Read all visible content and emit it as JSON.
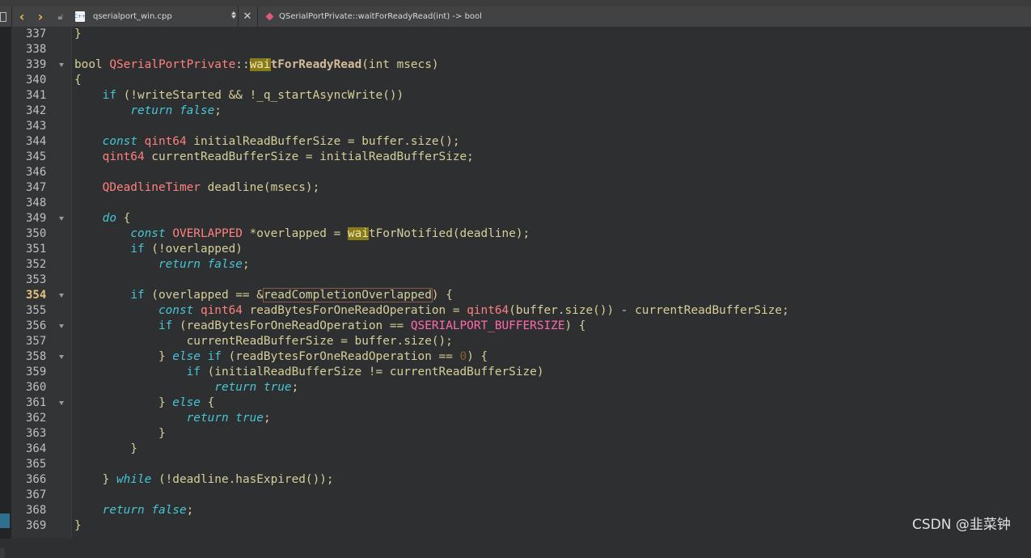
{
  "toolbar": {
    "file_name": "qserialport_win.cpp",
    "file_icon_text": "C++",
    "symbol": "QSerialPortPrivate::waitForReadyRead(int) -> bool"
  },
  "gutter": {
    "lines": [
      {
        "n": "337"
      },
      {
        "n": "338"
      },
      {
        "n": "339",
        "fold": true
      },
      {
        "n": "340"
      },
      {
        "n": "341"
      },
      {
        "n": "342"
      },
      {
        "n": "343"
      },
      {
        "n": "344"
      },
      {
        "n": "345"
      },
      {
        "n": "346"
      },
      {
        "n": "347"
      },
      {
        "n": "348"
      },
      {
        "n": "349",
        "fold": true
      },
      {
        "n": "350"
      },
      {
        "n": "351"
      },
      {
        "n": "352"
      },
      {
        "n": "353"
      },
      {
        "n": "354",
        "fold": true,
        "current": true
      },
      {
        "n": "355"
      },
      {
        "n": "356",
        "fold": true
      },
      {
        "n": "357"
      },
      {
        "n": "358",
        "fold": true
      },
      {
        "n": "359"
      },
      {
        "n": "360"
      },
      {
        "n": "361",
        "fold": true
      },
      {
        "n": "362"
      },
      {
        "n": "363"
      },
      {
        "n": "364"
      },
      {
        "n": "365"
      },
      {
        "n": "366"
      },
      {
        "n": "367"
      },
      {
        "n": "368"
      },
      {
        "n": "369"
      }
    ]
  },
  "code": [
    [
      [
        "p",
        "}"
      ]
    ],
    [],
    [
      [
        "p",
        "bool "
      ],
      [
        "t",
        "QSerialPortPrivate"
      ],
      [
        "p",
        "::"
      ],
      [
        "hl",
        "wai"
      ],
      [
        "f",
        "tForReadyRead"
      ],
      [
        "p",
        "(int msecs)"
      ]
    ],
    [
      [
        "p",
        "{"
      ]
    ],
    [
      [
        "p",
        "    "
      ],
      [
        "k",
        "if"
      ],
      [
        "p",
        " (!writeStarted && !_q_startAsyncWrite())"
      ]
    ],
    [
      [
        "p",
        "        "
      ],
      [
        "ki",
        "return"
      ],
      [
        "p",
        " "
      ],
      [
        "ki",
        "false"
      ],
      [
        "p",
        ";"
      ]
    ],
    [],
    [
      [
        "p",
        "    "
      ],
      [
        "ki",
        "const"
      ],
      [
        "p",
        " "
      ],
      [
        "t",
        "qint64"
      ],
      [
        "p",
        " initialReadBufferSize = buffer.size();"
      ]
    ],
    [
      [
        "p",
        "    "
      ],
      [
        "t",
        "qint64"
      ],
      [
        "p",
        " currentReadBufferSize = initialReadBufferSize;"
      ]
    ],
    [],
    [
      [
        "p",
        "    "
      ],
      [
        "t",
        "QDeadlineTimer"
      ],
      [
        "p",
        " deadline(msecs);"
      ]
    ],
    [],
    [
      [
        "p",
        "    "
      ],
      [
        "ki",
        "do"
      ],
      [
        "p",
        " {"
      ]
    ],
    [
      [
        "p",
        "        "
      ],
      [
        "ki",
        "const"
      ],
      [
        "p",
        " "
      ],
      [
        "t",
        "OVERLAPPED"
      ],
      [
        "p",
        " *overlapped = "
      ],
      [
        "hl",
        "wai"
      ],
      [
        "p",
        "tForNotified(deadline);"
      ]
    ],
    [
      [
        "p",
        "        "
      ],
      [
        "k",
        "if"
      ],
      [
        "p",
        " (!overlapped)"
      ]
    ],
    [
      [
        "p",
        "            "
      ],
      [
        "ki",
        "return"
      ],
      [
        "p",
        " "
      ],
      [
        "ki",
        "false"
      ],
      [
        "p",
        ";"
      ]
    ],
    [],
    [
      [
        "p",
        "        "
      ],
      [
        "k",
        "if"
      ],
      [
        "p",
        " (overlapped == &"
      ],
      [
        "box",
        "readCompletionOverlapped"
      ],
      [
        "p",
        ") {"
      ]
    ],
    [
      [
        "p",
        "            "
      ],
      [
        "ki",
        "const"
      ],
      [
        "p",
        " "
      ],
      [
        "t",
        "qint64"
      ],
      [
        "p",
        " readBytesForOneReadOperation = "
      ],
      [
        "t",
        "qint64"
      ],
      [
        "p",
        "(buffer.size()) - currentReadBufferSize;"
      ]
    ],
    [
      [
        "p",
        "            "
      ],
      [
        "k",
        "if"
      ],
      [
        "p",
        " (readBytesForOneReadOperation == "
      ],
      [
        "m",
        "QSERIALPORT_BUFFERSIZE"
      ],
      [
        "p",
        ") {"
      ]
    ],
    [
      [
        "p",
        "                currentReadBufferSize = buffer.size();"
      ]
    ],
    [
      [
        "p",
        "            } "
      ],
      [
        "ki",
        "else"
      ],
      [
        "p",
        " "
      ],
      [
        "k",
        "if"
      ],
      [
        "p",
        " (readBytesForOneReadOperation == "
      ],
      [
        "n",
        "0"
      ],
      [
        "p",
        ") {"
      ]
    ],
    [
      [
        "p",
        "                "
      ],
      [
        "k",
        "if"
      ],
      [
        "p",
        " (initialReadBufferSize != currentReadBufferSize)"
      ]
    ],
    [
      [
        "p",
        "                    "
      ],
      [
        "ki",
        "return"
      ],
      [
        "p",
        " "
      ],
      [
        "ki",
        "true"
      ],
      [
        "p",
        ";"
      ]
    ],
    [
      [
        "p",
        "            } "
      ],
      [
        "ki",
        "else"
      ],
      [
        "p",
        " {"
      ]
    ],
    [
      [
        "p",
        "                "
      ],
      [
        "ki",
        "return"
      ],
      [
        "p",
        " "
      ],
      [
        "ki",
        "true"
      ],
      [
        "p",
        ";"
      ]
    ],
    [
      [
        "p",
        "            }"
      ]
    ],
    [
      [
        "p",
        "        }"
      ]
    ],
    [],
    [
      [
        "p",
        "    } "
      ],
      [
        "ki",
        "while"
      ],
      [
        "p",
        " (!deadline.hasExpired());"
      ]
    ],
    [],
    [
      [
        "p",
        "    "
      ],
      [
        "ki",
        "return"
      ],
      [
        "p",
        " "
      ],
      [
        "ki",
        "false"
      ],
      [
        "p",
        ";"
      ]
    ],
    [
      [
        "p",
        "}"
      ]
    ]
  ],
  "watermark": "CSDN @韭菜钟"
}
